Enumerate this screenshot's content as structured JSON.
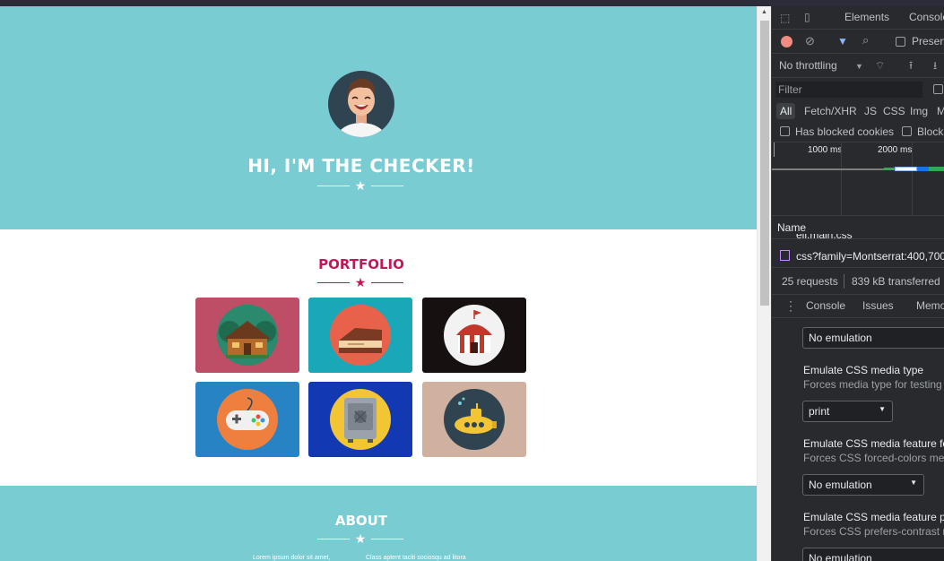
{
  "colors": {
    "hero_bg": "#7accd3",
    "accent": "#c2185b",
    "white": "#ffffff",
    "devtools_bg": "#292a2d"
  },
  "page": {
    "hero": {
      "title": "HI, I'M THE CHECKER!",
      "avatar": "avatar-illustration"
    },
    "portfolio": {
      "title": "PORTFOLIO",
      "tiles": [
        {
          "name": "log-cabin",
          "bg": "#bd4e66",
          "disc": "#2b8a6e"
        },
        {
          "name": "cake-slice",
          "bg": "#1aa8b8",
          "disc": "#e8614a"
        },
        {
          "name": "circus-tent",
          "bg": "#161010",
          "disc": "#f2f2f2"
        },
        {
          "name": "game-controller",
          "bg": "#2783c3",
          "disc": "#ee7f3e"
        },
        {
          "name": "safe",
          "bg": "#1238b2",
          "disc": "#f2c534"
        },
        {
          "name": "submarine",
          "bg": "#d0b09f",
          "disc": "#2f4450"
        }
      ]
    },
    "about": {
      "title": "ABOUT",
      "text_left": "Lorem ipsum dolor sit amet,",
      "text_right": "Class aptent taciti sociosqu ad litora"
    }
  },
  "devtools": {
    "tabs": [
      "Elements",
      "Console"
    ],
    "network": {
      "preserve_label": "Preserv",
      "throttling": "No throttling",
      "filter_placeholder": "Filter",
      "types": [
        "All",
        "Fetch/XHR",
        "JS",
        "CSS",
        "Img",
        "M"
      ],
      "has_blocked_cookies": "Has blocked cookies",
      "blocked_label": "Block",
      "timeline": [
        "1000 ms",
        "2000 ms"
      ],
      "name_header": "Name",
      "partial_row": "ell.main.css",
      "row": "css?family=Montserrat:400,700",
      "requests": "25 requests",
      "transferred": "839 kB transferred"
    },
    "drawer": {
      "tabs": [
        "Console",
        "Issues",
        "Memo"
      ],
      "dropdown1": "No emulation",
      "media_type_label": "Emulate CSS media type",
      "media_type_desc": "Forces media type for testing p",
      "media_type_value": "print",
      "forced_colors_label": "Emulate CSS media feature for",
      "forced_colors_desc": "Forces CSS forced-colors med",
      "forced_colors_value": "No emulation",
      "contrast_label": "Emulate CSS media feature pre",
      "contrast_desc": "Forces CSS prefers-contrast m",
      "contrast_value": "No emulation"
    }
  }
}
